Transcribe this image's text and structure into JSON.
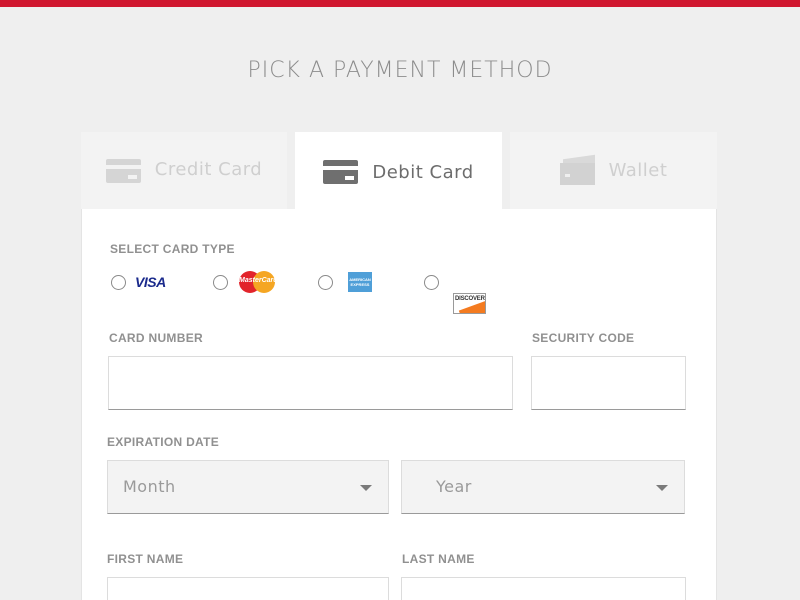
{
  "page_title": "PICK A PAYMENT METHOD",
  "colors": {
    "accent": "#d0172f",
    "background": "#efefef",
    "panel": "#ffffff"
  },
  "tabs": [
    {
      "label": "Credit Card",
      "icon": "credit-card-icon",
      "active": false
    },
    {
      "label": "Debit Card",
      "icon": "debit-card-icon",
      "active": true
    },
    {
      "label": "Wallet",
      "icon": "wallet-icon",
      "active": false
    }
  ],
  "card_type": {
    "label": "SELECT CARD TYPE",
    "options": [
      {
        "name": "Visa",
        "logo_text": "VISA",
        "icon": "visa-logo"
      },
      {
        "name": "MasterCard",
        "logo_text": "MasterCard",
        "icon": "mastercard-logo"
      },
      {
        "name": "American Express",
        "logo_text": "AMERICAN EXPRESS",
        "icon": "amex-logo"
      },
      {
        "name": "Discover",
        "logo_text": "DISCOVER",
        "icon": "discover-logo"
      }
    ]
  },
  "card_number": {
    "label": "CARD NUMBER",
    "value": ""
  },
  "security_code": {
    "label": "SECURITY CODE",
    "value": ""
  },
  "expiration": {
    "label": "EXPIRATION DATE",
    "month": {
      "selected": "Month"
    },
    "year": {
      "selected": "Year"
    }
  },
  "first_name": {
    "label": "FIRST NAME",
    "value": ""
  },
  "last_name": {
    "label": "LAST NAME",
    "value": ""
  }
}
